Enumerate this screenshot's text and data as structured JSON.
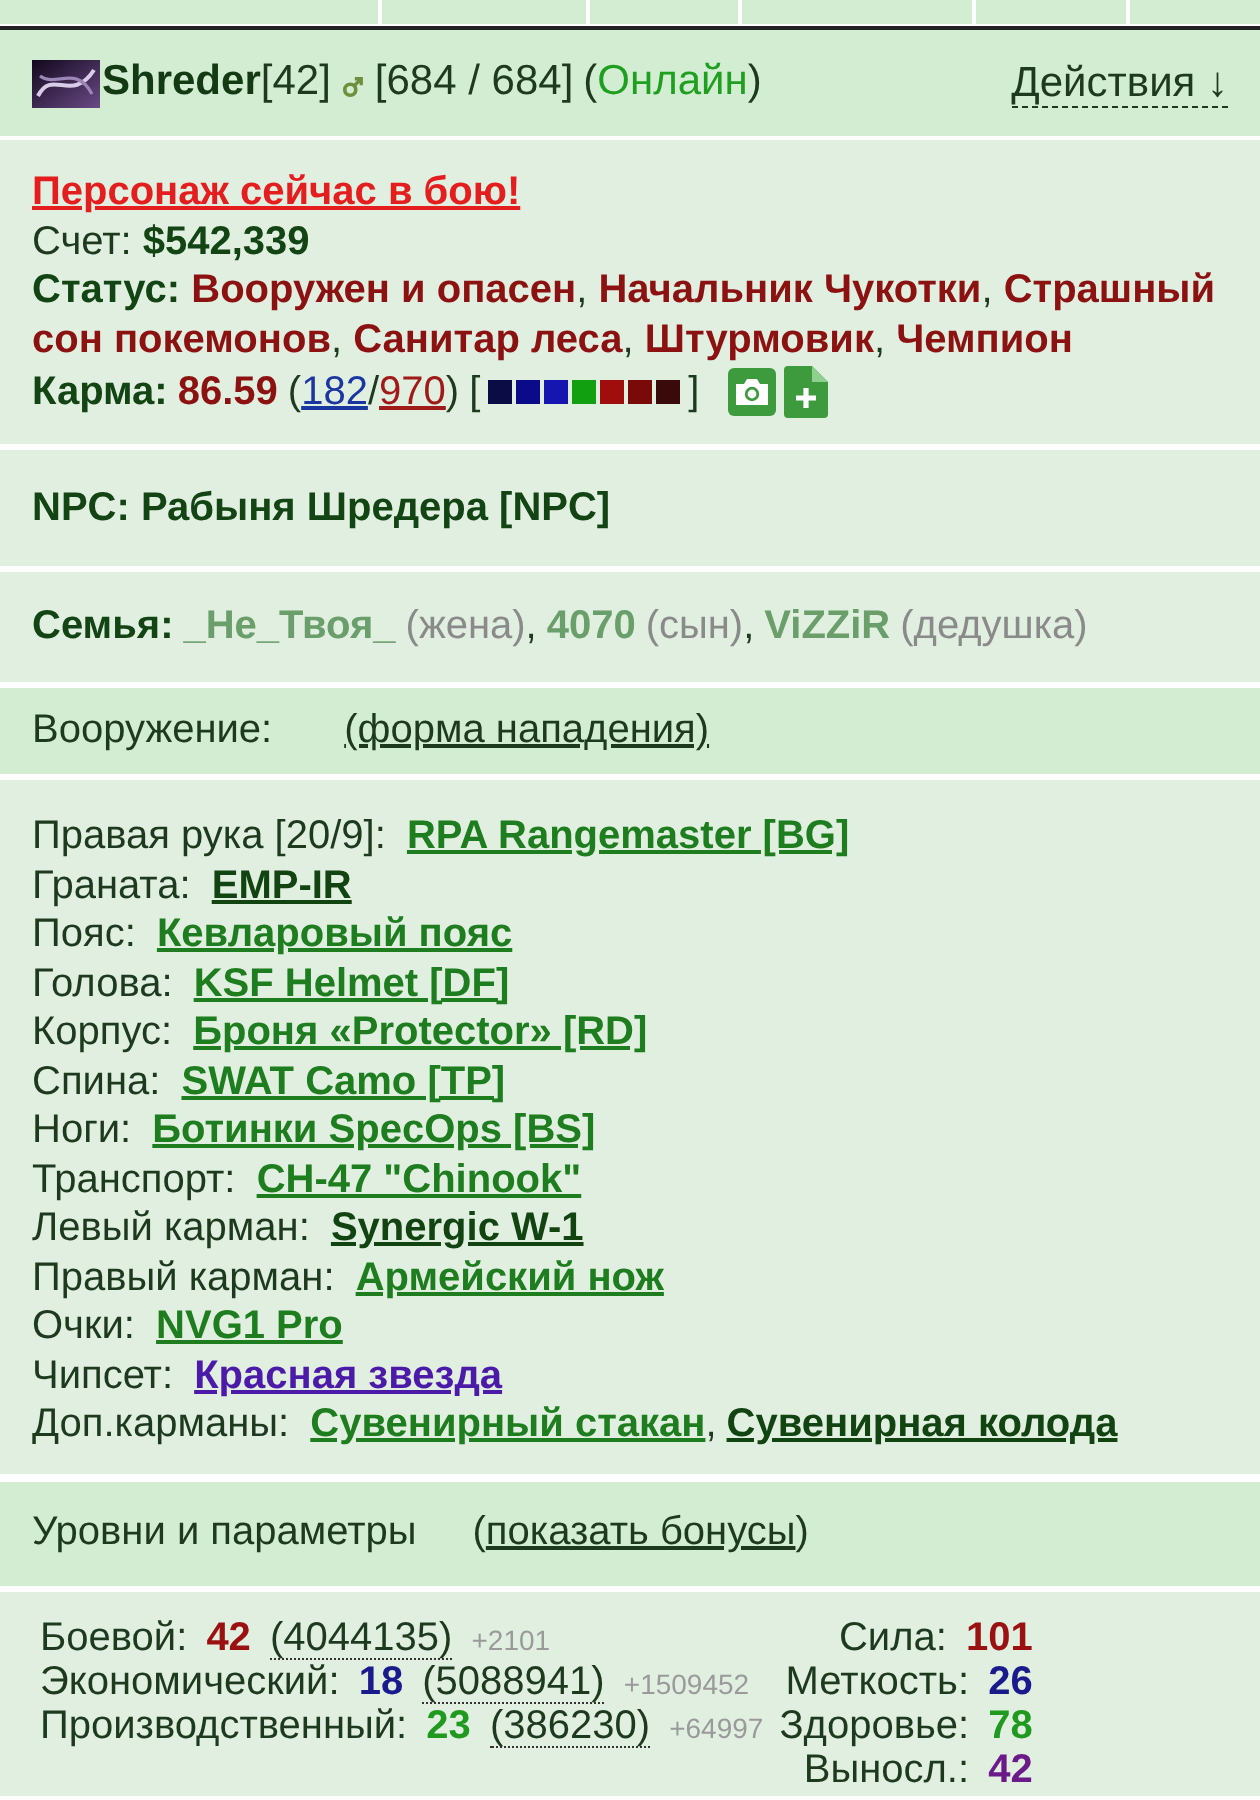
{
  "header": {
    "name": "Shreder",
    "level": "[42]",
    "hp": "[684 / 684]",
    "presence": {
      "open": "(",
      "label": "Онлайн",
      "close": ")",
      "online": true
    },
    "actions": "Действия ↓"
  },
  "profile": {
    "alert": "Персонаж сейчас в бою!",
    "account": {
      "label": "Счет:",
      "value": "$542,339"
    },
    "status": {
      "label": "Статус:",
      "titles": [
        {
          "text": "Вооружен и опасен",
          "sep": ","
        },
        {
          "text": "Начальник Чукотки",
          "sep": ","
        },
        {
          "text": "Страшный сон покемонов",
          "sep": ","
        },
        {
          "text": "Санитар леса",
          "sep": ","
        },
        {
          "text": "Штурмовик",
          "sep": ","
        },
        {
          "text": "Чемпион"
        }
      ]
    },
    "karma": {
      "label": "Карма:",
      "value": "86.59",
      "open": "(",
      "positive": "182",
      "slash": "/",
      "negative": "970",
      "close": ")",
      "bracket_open": "[",
      "swatches": [
        {
          "color": "#0b0b45"
        },
        {
          "color": "#0a0a8a"
        },
        {
          "color": "#1515b0"
        },
        {
          "color": "#10a010"
        },
        {
          "color": "#a00d0d"
        },
        {
          "color": "#7a0a0a"
        },
        {
          "color": "#3a0a0a"
        }
      ],
      "bracket_close": "]"
    }
  },
  "npc": {
    "label": "NPC:",
    "name": "Рабыня Шредера [NPC]"
  },
  "family": {
    "label": "Семья:",
    "members": [
      {
        "name": "_Не_Твоя_",
        "relation": "(жена)",
        "sep": ","
      },
      {
        "name": "4070",
        "relation": "(сын)",
        "sep": ","
      },
      {
        "name": "ViZZiR",
        "relation": "(дедушка)"
      }
    ]
  },
  "equipment": {
    "title": "Вооружение:",
    "form_link": "(форма нападения)",
    "slots": [
      {
        "label": "Правая рука [20/9]:",
        "items": [
          {
            "name": "RPA Rangemaster [BG]",
            "color": "#1e7d1e"
          }
        ]
      },
      {
        "label": "Граната:",
        "items": [
          {
            "name": "EMP-IR",
            "color": "#124412"
          }
        ]
      },
      {
        "label": "Пояс:",
        "items": [
          {
            "name": "Кевларовый пояс",
            "color": "#1e7d1e"
          }
        ]
      },
      {
        "label": "Голова:",
        "items": [
          {
            "name": "KSF Helmet [DF]",
            "color": "#1e7d1e"
          }
        ]
      },
      {
        "label": "Корпус:",
        "items": [
          {
            "name": "Броня «Protector» [RD]",
            "color": "#1e7d1e"
          }
        ]
      },
      {
        "label": "Спина:",
        "items": [
          {
            "name": "SWAT Camo [TP]",
            "color": "#1e7d1e"
          }
        ]
      },
      {
        "label": "Ноги:",
        "items": [
          {
            "name": "Ботинки SpecOps [BS]",
            "color": "#1e7d1e"
          }
        ]
      },
      {
        "label": "Транспорт:",
        "items": [
          {
            "name": "CH-47 \"Chinook\"",
            "color": "#1e7d1e"
          }
        ]
      },
      {
        "label": "Левый карман:",
        "items": [
          {
            "name": "Synergic W-1",
            "color": "#124412"
          }
        ]
      },
      {
        "label": "Правый карман:",
        "items": [
          {
            "name": "Армейский нож",
            "color": "#1e7d1e"
          }
        ]
      },
      {
        "label": "Очки:",
        "items": [
          {
            "name": "NVG1 Pro",
            "color": "#1e7d1e"
          }
        ]
      },
      {
        "label": "Чипсет:",
        "items": [
          {
            "name": "Красная звезда",
            "color": "#4b1aa8"
          }
        ]
      },
      {
        "label": "Доп.карманы:",
        "items": [
          {
            "name": "Сувенирный стакан",
            "color": "#1e7d1e",
            "sep": ","
          },
          {
            "name": "Сувенирная колода",
            "color": "#124412"
          }
        ]
      }
    ]
  },
  "levels": {
    "title": "Уровни и параметры",
    "open": "(",
    "link": "показать бонусы",
    "close": ")",
    "skills": [
      {
        "label": "Боевой:",
        "level": "42",
        "color": "#9b1111",
        "exp": "(4044135)",
        "bonus": "+2101"
      },
      {
        "label": "Экономический:",
        "level": "18",
        "color": "#1a1a8c",
        "exp": "(5088941)",
        "bonus": "+1509452"
      },
      {
        "label": "Производственный:",
        "level": "23",
        "color": "#1f9a1f",
        "exp": "(386230)",
        "bonus": "+64997"
      }
    ],
    "attributes": [
      {
        "label": "Сила:",
        "value": "101",
        "color": "#9b1111"
      },
      {
        "label": "Меткость:",
        "value": "26",
        "color": "#1a1a8c"
      },
      {
        "label": "Здоровье:",
        "value": "78",
        "color": "#1f9a1f"
      },
      {
        "label": "Выносл.:",
        "value": "42",
        "color": "#6b1a8a"
      }
    ]
  }
}
